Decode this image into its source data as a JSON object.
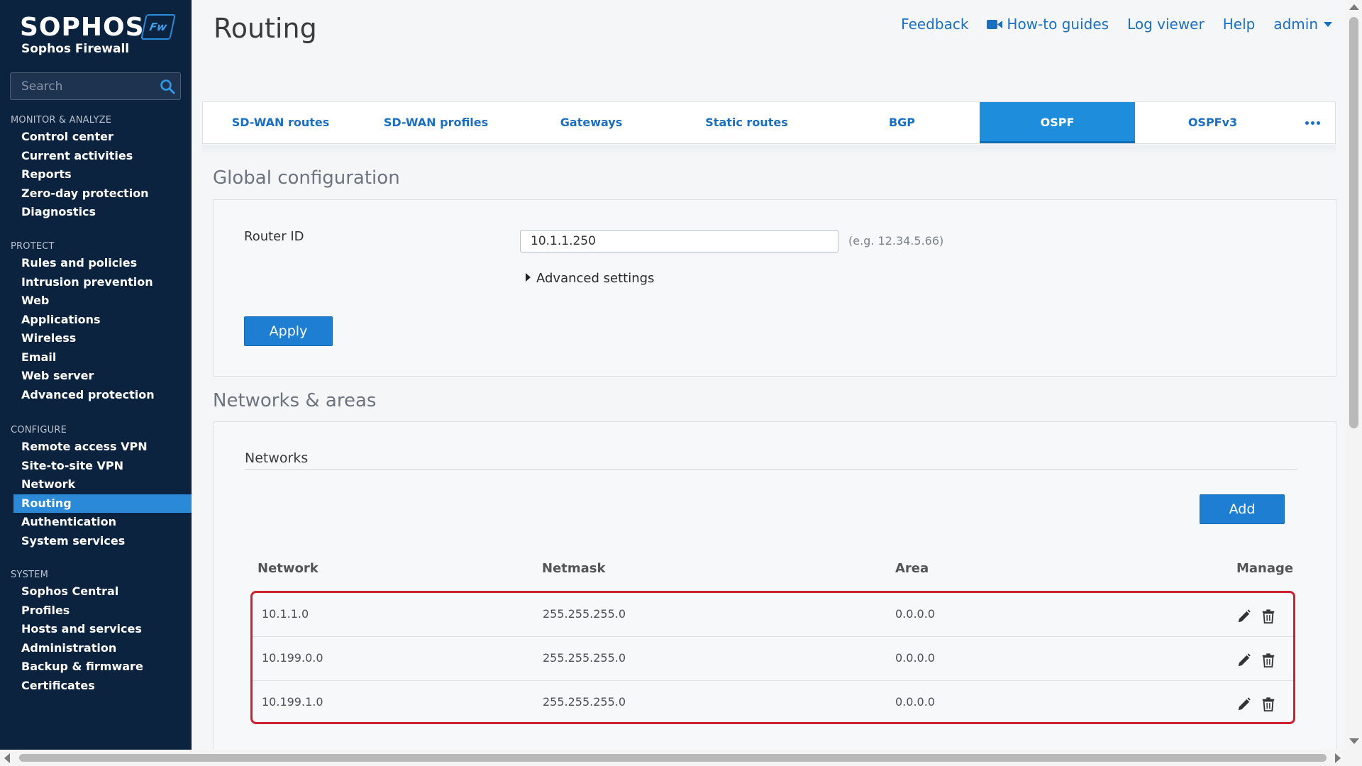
{
  "brand": {
    "logo": "SOPHOS",
    "badge": "Fw",
    "product": "Sophos Firewall"
  },
  "search": {
    "placeholder": "Search"
  },
  "sidebar": {
    "sections": [
      {
        "heading": "MONITOR & ANALYZE",
        "items": [
          "Control center",
          "Current activities",
          "Reports",
          "Zero-day protection",
          "Diagnostics"
        ]
      },
      {
        "heading": "PROTECT",
        "items": [
          "Rules and policies",
          "Intrusion prevention",
          "Web",
          "Applications",
          "Wireless",
          "Email",
          "Web server",
          "Advanced protection"
        ]
      },
      {
        "heading": "CONFIGURE",
        "items": [
          "Remote access VPN",
          "Site-to-site VPN",
          "Network",
          "Routing",
          "Authentication",
          "System services"
        ]
      },
      {
        "heading": "SYSTEM",
        "items": [
          "Sophos Central",
          "Profiles",
          "Hosts and services",
          "Administration",
          "Backup & firmware",
          "Certificates"
        ]
      }
    ],
    "active": "Routing"
  },
  "header": {
    "title": "Routing",
    "links": {
      "feedback": "Feedback",
      "howto": "How-to guides",
      "logviewer": "Log viewer",
      "help": "Help",
      "user": "admin"
    }
  },
  "tabs": [
    "SD-WAN routes",
    "SD-WAN profiles",
    "Gateways",
    "Static routes",
    "BGP",
    "OSPF",
    "OSPFv3"
  ],
  "active_tab": "OSPF",
  "global_config": {
    "title": "Global configuration",
    "router_id_label": "Router ID",
    "router_id_value": "10.1.1.250",
    "router_id_hint": "(e.g. 12.34.5.66)",
    "advanced_label": "Advanced settings",
    "apply_label": "Apply"
  },
  "networks": {
    "title": "Networks & areas",
    "subheading": "Networks",
    "add_label": "Add",
    "columns": {
      "network": "Network",
      "netmask": "Netmask",
      "area": "Area",
      "manage": "Manage"
    },
    "rows": [
      {
        "network": "10.1.1.0",
        "netmask": "255.255.255.0",
        "area": "0.0.0.0"
      },
      {
        "network": "10.199.0.0",
        "netmask": "255.255.255.0",
        "area": "0.0.0.0"
      },
      {
        "network": "10.199.1.0",
        "netmask": "255.255.255.0",
        "area": "0.0.0.0"
      }
    ]
  },
  "colors": {
    "sidebar_bg": "#0c2340",
    "accent": "#1e8edc",
    "link": "#1a6fc0",
    "highlight_border": "#cc2230"
  }
}
